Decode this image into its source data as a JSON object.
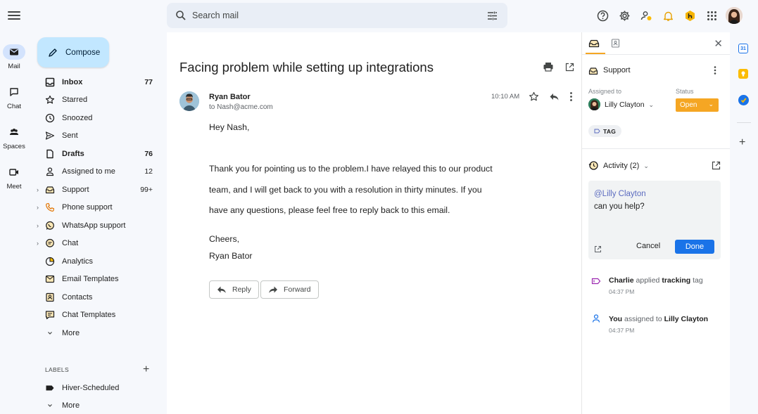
{
  "rail": {
    "items": [
      {
        "label": "Mail"
      },
      {
        "label": "Chat"
      },
      {
        "label": "Spaces"
      },
      {
        "label": "Meet"
      }
    ]
  },
  "sidebar": {
    "compose_label": "Compose",
    "items": [
      {
        "label": "Inbox",
        "count": "77",
        "icon": "inbox-icon"
      },
      {
        "label": "Starred",
        "count": "",
        "icon": "star-icon"
      },
      {
        "label": "Snoozed",
        "count": "",
        "icon": "clock-icon"
      },
      {
        "label": "Sent",
        "count": "",
        "icon": "send-icon"
      },
      {
        "label": "Drafts",
        "count": "76",
        "icon": "draft-icon"
      },
      {
        "label": "Assigned to me",
        "count": "12",
        "icon": "person-icon"
      },
      {
        "label": "Support",
        "count": "99+",
        "icon": "support-inbox-icon"
      },
      {
        "label": "Phone support",
        "count": "",
        "icon": "phone-icon"
      },
      {
        "label": "WhatsApp support",
        "count": "",
        "icon": "whatsapp-icon"
      },
      {
        "label": "Chat",
        "count": "",
        "icon": "chat-bubble-icon"
      },
      {
        "label": "Analytics",
        "count": "",
        "icon": "pie-chart-icon"
      },
      {
        "label": "Email Templates",
        "count": "",
        "icon": "email-template-icon"
      },
      {
        "label": "Contacts",
        "count": "",
        "icon": "contacts-icon"
      },
      {
        "label": "Chat Templates",
        "count": "",
        "icon": "chat-template-icon"
      },
      {
        "label": "More",
        "count": "",
        "icon": "chevron-down-icon"
      }
    ],
    "labels_heading": "LABELS",
    "labels": [
      {
        "label": "Hiver-Scheduled"
      },
      {
        "label": "More"
      }
    ]
  },
  "search": {
    "placeholder": "Search mail"
  },
  "mail": {
    "subject": "Facing problem while setting up integrations",
    "sender_name": "Ryan Bator",
    "to_line": "to Nash@acme.com",
    "time": "10:10 AM",
    "greeting": "Hey Nash,",
    "body_lines": [
      "Thank you for pointing us to the problem.I have relayed this to our product",
      "team, and I will get back to you with a resolution in thirty minutes. If you",
      "have any questions, please feel free to reply back to this email."
    ],
    "signoff": "Cheers,",
    "signature": "Ryan Bator",
    "reply_label": "Reply",
    "forward_label": "Forward"
  },
  "panel": {
    "inbox_name": "Support",
    "assigned_to_label": "Assigned to",
    "assignee": "Lilly Clayton",
    "status_label": "Status",
    "status_value": "Open",
    "status_color": "#f5a623",
    "tag_label": "TAG",
    "activity_label": "Activity (2)",
    "comment_mention": "@Lilly Clayton",
    "comment_text": "can you help?",
    "cancel_label": "Cancel",
    "done_label": "Done",
    "accent_color": "#1a73e8",
    "activity_log": [
      {
        "actor": "Charlie",
        "action": "applied",
        "object": "tracking",
        "suffix": "tag",
        "time": "04:37 PM"
      },
      {
        "actor": "You",
        "action": "assigned to",
        "object": "Lilly Clayton",
        "suffix": "",
        "time": "04:37 PM"
      }
    ]
  },
  "strip": {
    "calendar_text": "31"
  }
}
